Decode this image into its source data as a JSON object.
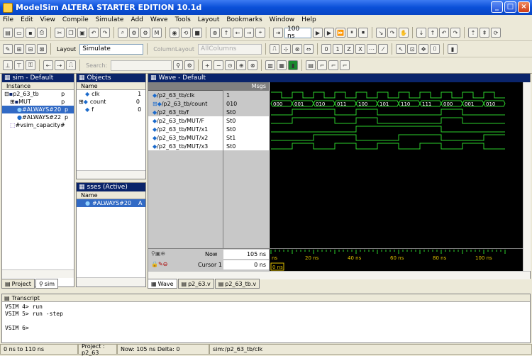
{
  "window": {
    "title": "ModelSim ALTERA STARTER EDITION 10.1d"
  },
  "menu": [
    "File",
    "Edit",
    "View",
    "Compile",
    "Simulate",
    "Add",
    "Wave",
    "Tools",
    "Layout",
    "Bookmarks",
    "Window",
    "Help"
  ],
  "toolbar": {
    "run_length": "100 ns",
    "layout_label": "Layout",
    "layout_value": "Simulate",
    "column_layout_label": "ColumnLayout",
    "column_layout_value": "AllColumns",
    "search_label": "Search:"
  },
  "sim_pane": {
    "title": "sim - Default",
    "col_instance": "Instance",
    "rows": [
      {
        "label": "p2_63_tb",
        "extra": "p"
      },
      {
        "label": "MUT",
        "extra": "p"
      },
      {
        "label": "#ALWAYS#20",
        "extra": "p"
      },
      {
        "label": "#ALWAYS#22",
        "extra": "p"
      },
      {
        "label": "#vsim_capacity#",
        "extra": ""
      }
    ],
    "tabs": [
      "Project",
      "sim"
    ]
  },
  "objects_pane": {
    "title": "Objects",
    "col_name": "Name",
    "rows": [
      {
        "label": "clk",
        "val": "1"
      },
      {
        "label": "count",
        "val": "0"
      },
      {
        "label": "f",
        "val": "0"
      }
    ]
  },
  "processes_pane": {
    "title": "sses (Active)",
    "col_name": "Name",
    "rows": [
      {
        "label": "#ALWAYS#20",
        "val": "A"
      }
    ]
  },
  "wave": {
    "title": "Wave - Default",
    "msgs_header": "Msgs",
    "signals": [
      {
        "name": "/p2_63_tb/clk",
        "value": "1"
      },
      {
        "name": "/p2_63_tb/count",
        "value": "010"
      },
      {
        "name": "/p2_63_tb/f",
        "value": "St0"
      },
      {
        "name": "/p2_63_tb/MUT/F",
        "value": "St0"
      },
      {
        "name": "/p2_63_tb/MUT/x1",
        "value": "St0"
      },
      {
        "name": "/p2_63_tb/MUT/x2",
        "value": "St1"
      },
      {
        "name": "/p2_63_tb/MUT/x3",
        "value": "St0"
      }
    ],
    "count_labels": [
      "000",
      "001",
      "010",
      "011",
      "100",
      "101",
      "110",
      "111",
      "000",
      "001",
      "010"
    ],
    "now_label": "Now",
    "now_value": "105 ns",
    "cursor_label": "Cursor 1",
    "cursor_value": "0 ns",
    "cursor_time_tag": "0 ns",
    "ticks": [
      "20 ns",
      "40 ns",
      "60 ns",
      "80 ns",
      "100 ns"
    ],
    "tick_start": "ns",
    "tabs": [
      "Wave",
      "p2_63.v",
      "p2_63_tb.v"
    ]
  },
  "transcript": {
    "title": "Transcript",
    "lines": [
      "VSIM 4> run",
      "VSIM 5> run -step",
      "",
      "VSIM 6>"
    ]
  },
  "status": {
    "range": "0 ns to 110 ns",
    "project": "Project : p2_63",
    "now": "Now: 105 ns  Delta: 0",
    "path": "sim:/p2_63_tb/clk"
  }
}
